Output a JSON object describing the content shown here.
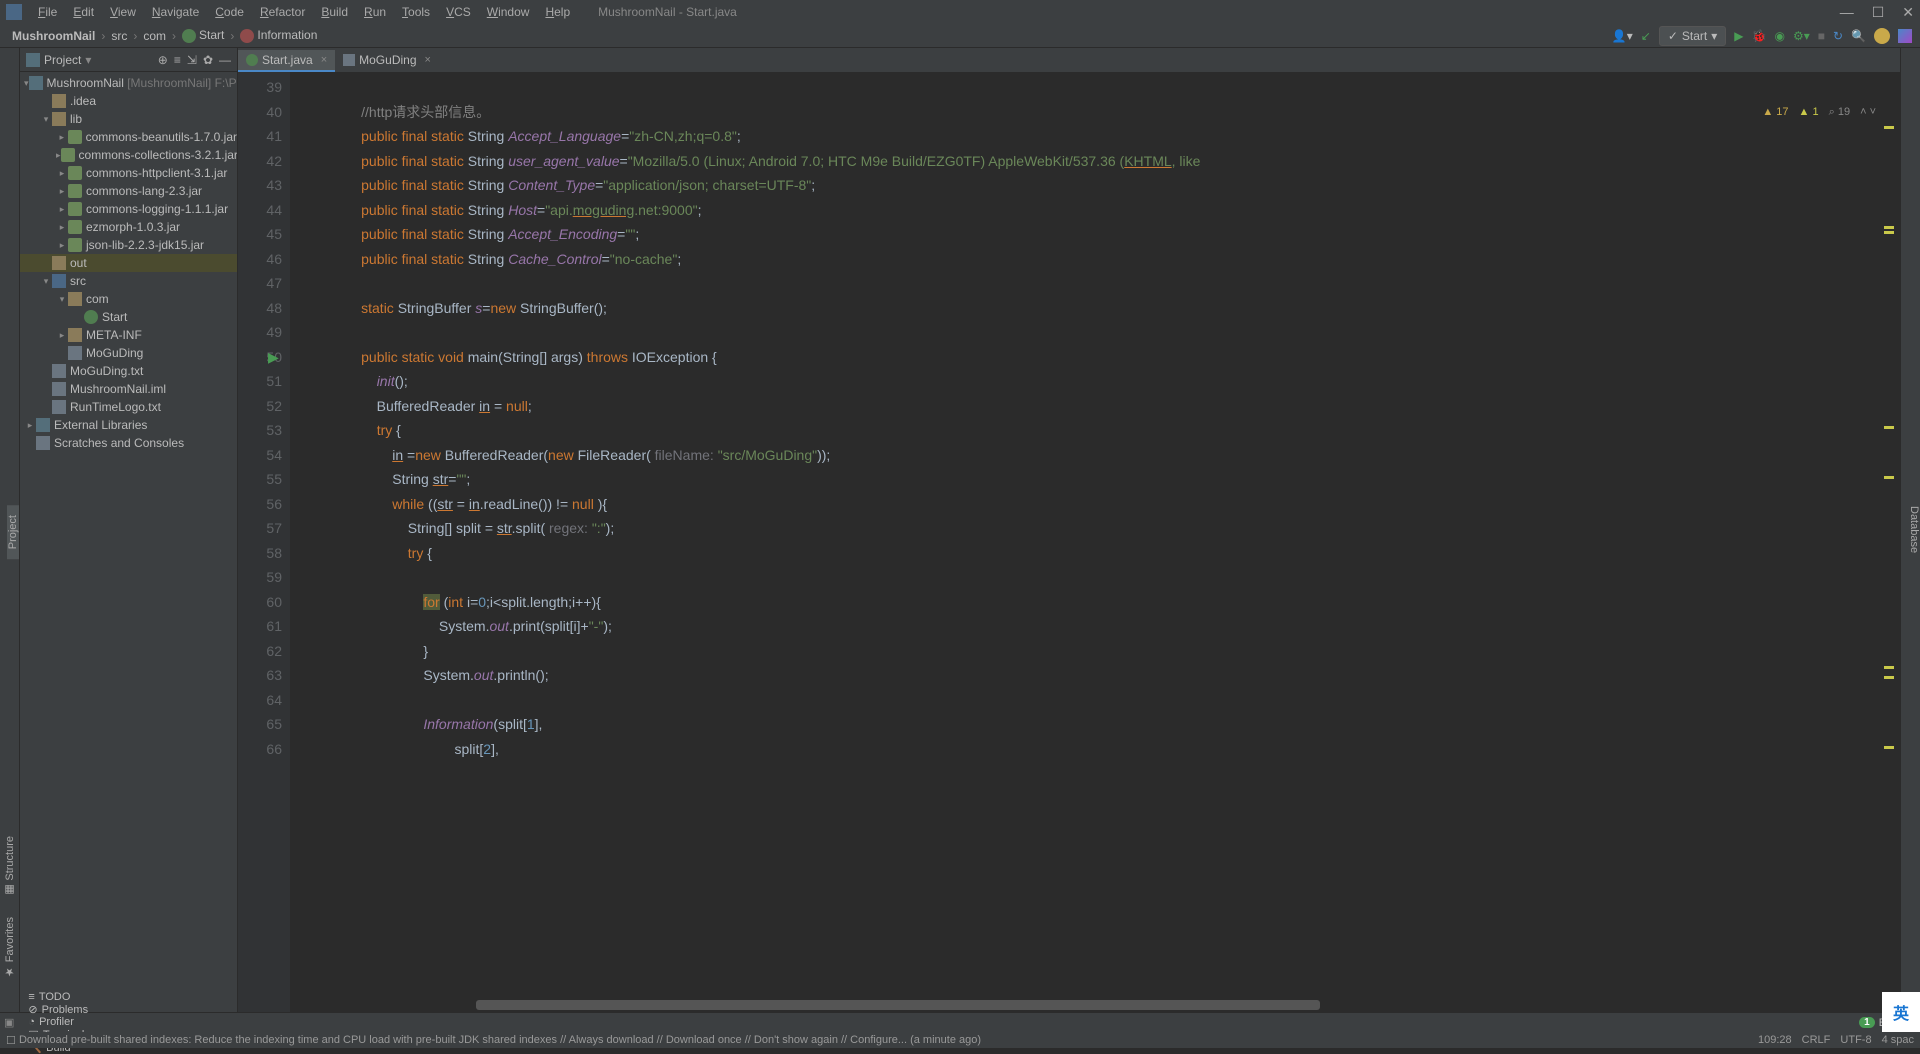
{
  "app_title": "MushroomNail - Start.java",
  "menus": [
    "File",
    "Edit",
    "View",
    "Navigate",
    "Code",
    "Refactor",
    "Build",
    "Run",
    "Tools",
    "VCS",
    "Window",
    "Help"
  ],
  "breadcrumb": {
    "project": "MushroomNail",
    "parts": [
      "src",
      "com",
      "Start",
      "Information"
    ]
  },
  "run_config": "Start",
  "panel": {
    "title": "Project"
  },
  "tree": [
    {
      "depth": 0,
      "arrow": "▾",
      "icon": "ico-module",
      "label": "MushroomNail",
      "suffix": " [MushroomNail]  F:\\Pc"
    },
    {
      "depth": 1,
      "arrow": "",
      "icon": "ico-folder",
      "label": ".idea"
    },
    {
      "depth": 1,
      "arrow": "▾",
      "icon": "ico-folder",
      "label": "lib"
    },
    {
      "depth": 2,
      "arrow": "▸",
      "icon": "ico-jar",
      "label": "commons-beanutils-1.7.0.jar"
    },
    {
      "depth": 2,
      "arrow": "▸",
      "icon": "ico-jar",
      "label": "commons-collections-3.2.1.jar"
    },
    {
      "depth": 2,
      "arrow": "▸",
      "icon": "ico-jar",
      "label": "commons-httpclient-3.1.jar"
    },
    {
      "depth": 2,
      "arrow": "▸",
      "icon": "ico-jar",
      "label": "commons-lang-2.3.jar"
    },
    {
      "depth": 2,
      "arrow": "▸",
      "icon": "ico-jar",
      "label": "commons-logging-1.1.1.jar"
    },
    {
      "depth": 2,
      "arrow": "▸",
      "icon": "ico-jar",
      "label": "ezmorph-1.0.3.jar"
    },
    {
      "depth": 2,
      "arrow": "▸",
      "icon": "ico-jar",
      "label": "json-lib-2.2.3-jdk15.jar"
    },
    {
      "depth": 1,
      "arrow": "",
      "icon": "ico-folder",
      "label": "out",
      "sel": true
    },
    {
      "depth": 1,
      "arrow": "▾",
      "icon": "ico-folder-src",
      "label": "src"
    },
    {
      "depth": 2,
      "arrow": "▾",
      "icon": "ico-folder",
      "label": "com"
    },
    {
      "depth": 3,
      "arrow": "",
      "icon": "ico-class",
      "label": "Start"
    },
    {
      "depth": 2,
      "arrow": "▸",
      "icon": "ico-folder",
      "label": "META-INF"
    },
    {
      "depth": 2,
      "arrow": "",
      "icon": "ico-file",
      "label": "MoGuDing"
    },
    {
      "depth": 1,
      "arrow": "",
      "icon": "ico-file",
      "label": "MoGuDing.txt"
    },
    {
      "depth": 1,
      "arrow": "",
      "icon": "ico-file",
      "label": "MushroomNail.iml"
    },
    {
      "depth": 1,
      "arrow": "",
      "icon": "ico-file",
      "label": "RunTimeLogo.txt"
    },
    {
      "depth": 0,
      "arrow": "▸",
      "icon": "ico-module",
      "label": "External Libraries"
    },
    {
      "depth": 0,
      "arrow": "",
      "icon": "ico-file",
      "label": "Scratches and Consoles"
    }
  ],
  "tabs": [
    {
      "icon": "c",
      "label": "Start.java",
      "active": true
    },
    {
      "icon": "f",
      "label": "MoGuDing",
      "active": false
    }
  ],
  "line_start": 39,
  "line_end": 66,
  "run_line": 50,
  "code_lines": [
    "",
    "        <span class='comment'>//http请求头部信息。</span>",
    "        <span class='kw'>public final static</span> String <span class='field'>Accept_Language</span>=<span class='str'>\"zh-CN,zh;q=0.8\"</span>;",
    "        <span class='kw'>public final static</span> String <span class='field'>user_agent_value</span>=<span class='str'>\"Mozilla/5.0 (Linux; Android 7.0; HTC M9e Build/EZG0TF) AppleWebKit/537.36 (<span class='uline'>KHTML</span>, like </span>",
    "        <span class='kw'>public final static</span> String <span class='field'>Content_Type</span>=<span class='str'>\"application/json; charset=UTF-8\"</span>;",
    "        <span class='kw'>public final static</span> String <span class='field'>Host</span>=<span class='str'>\"api.<span class='uline'>moguding</span>.net:9000\"</span>;",
    "        <span class='kw'>public final static</span> String <span class='field'>Accept_Encoding</span>=<span class='str'>\"\"</span>;",
    "        <span class='kw'>public final static</span> String <span class='field'>Cache_Control</span>=<span class='str'>\"no-cache\"</span>;",
    "",
    "        <span class='kw'>static</span> StringBuffer <span class='field'>s</span>=<span class='kw'>new</span> StringBuffer();",
    "",
    "        <span class='kw'>public static void</span> main(String[] args) <span class='kw'>throws</span> IOException {",
    "            <span class='field'>init</span>();",
    "            BufferedReader <span class='uline'>in</span> = <span class='kw'>null</span>;",
    "            <span class='kw'>try</span> {",
    "                <span class='uline'>in</span> =<span class='kw'>new</span> BufferedReader(<span class='kw'>new</span> FileReader( <span class='param'>fileName:</span> <span class='str'>\"src/MoGuDing\"</span>));",
    "                String <span class='uline'>str</span>=<span class='str'>\"\"</span>;",
    "                <span class='kw'>while</span> ((<span class='uline'>str</span> = <span class='uline'>in</span>.readLine()) != <span class='kw'>null</span> ){",
    "                    String[] split = <span class='uline'>str</span>.split( <span class='param'>regex:</span> <span class='str'>\":\"</span>);",
    "                    <span class='kw'>try</span> {",
    "",
    "                        <span class='hl-for'><span class='kw'>for</span></span> (<span class='kw'>int</span> i=<span class='num'>0</span>;i&lt;split.length;i++){",
    "                            System.<span class='field'>out</span>.print(split[i]+<span class='str'>\"-\"</span>);",
    "                        }",
    "                        System.<span class='field'>out</span>.println();",
    "",
    "                        <span class='field'>Information</span>(split[<span class='num'>1</span>],",
    "                                split[<span class='num'>2</span>],"
  ],
  "inspections": {
    "err": "17",
    "warn": "1",
    "weak": "19"
  },
  "bottom_tools": [
    "TODO",
    "Problems",
    "Profiler",
    "Terminal",
    "Build"
  ],
  "event_log": {
    "count": "1",
    "label": "Event L"
  },
  "status_msg": "Download pre-built shared indexes: Reduce the indexing time and CPU load with pre-built JDK shared indexes // Always download // Download once // Don't show again // Configure... (a minute ago)",
  "status_right": {
    "pos": "109:28",
    "eol": "CRLF",
    "enc": "UTF-8",
    "indent": "4 spac"
  },
  "left_labels": {
    "project": "Project",
    "structure": "Structure",
    "favorites": "Favorites"
  },
  "right_label": "Database",
  "ime": "英"
}
